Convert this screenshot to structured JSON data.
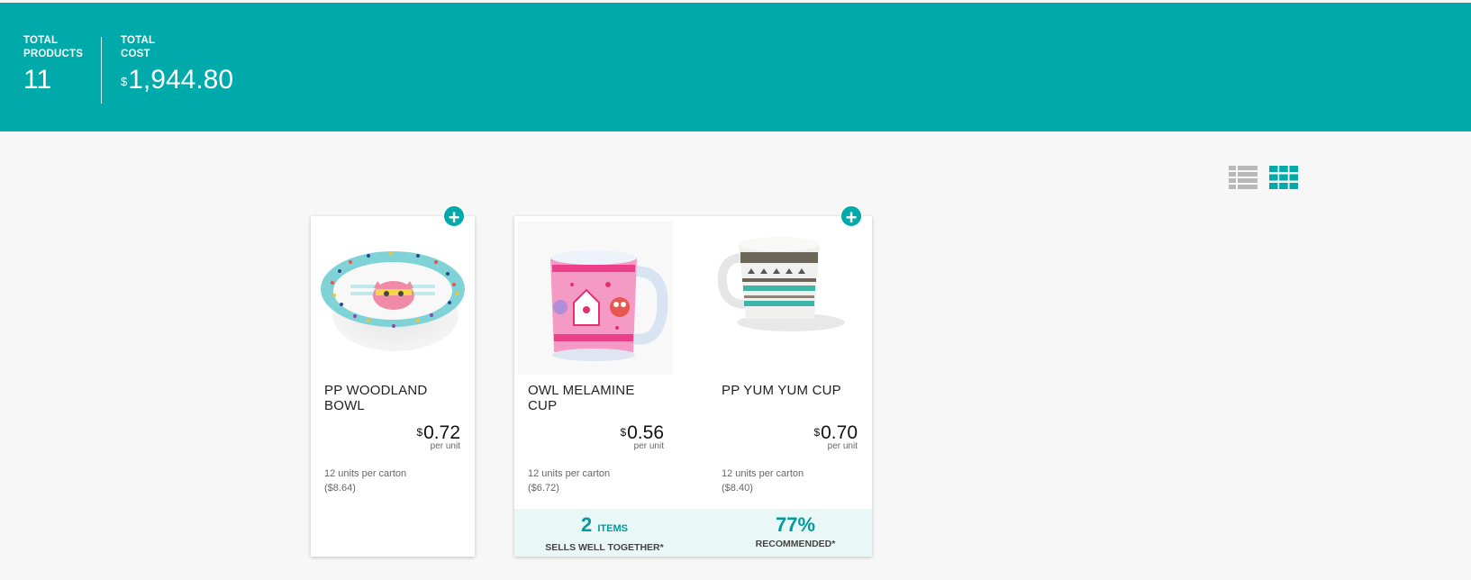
{
  "header": {
    "total_products": {
      "label_line1": "TOTAL",
      "label_line2": "PRODUCTS",
      "value": "11"
    },
    "total_cost": {
      "label_line1": "TOTAL",
      "label_line2": "COST",
      "currency": "$",
      "value": "1,944.80"
    }
  },
  "view_options": {
    "list_icon": "list-view-icon",
    "grid_icon": "grid-view-icon",
    "active": "grid",
    "active_color": "#00a9aa",
    "inactive_color": "#b8b8b8"
  },
  "products": [
    {
      "name": "PP WOODLAND BOWL",
      "currency": "$",
      "price": "0.72",
      "per_unit": "per unit",
      "units_per_carton": "12 units per carton",
      "carton_price": "($8.64)"
    },
    {
      "name": "OWL MELAMINE CUP",
      "currency": "$",
      "price": "0.56",
      "per_unit": "per unit",
      "units_per_carton": "12 units per carton",
      "carton_price": "($6.72)"
    },
    {
      "name": "PP YUM YUM CUP",
      "currency": "$",
      "price": "0.70",
      "per_unit": "per unit",
      "units_per_carton": "12 units per carton",
      "carton_price": "($8.40)"
    }
  ],
  "bundle": {
    "items_count": "2",
    "items_word": "ITEMS",
    "items_label": "SELLS WELL TOGETHER*",
    "recommended_value": "77%",
    "recommended_label": "RECOMMENDED*"
  },
  "colors": {
    "brand": "#00a9aa",
    "bundle_bg": "#e9f7f7",
    "page_bg": "#f7f7f7"
  }
}
